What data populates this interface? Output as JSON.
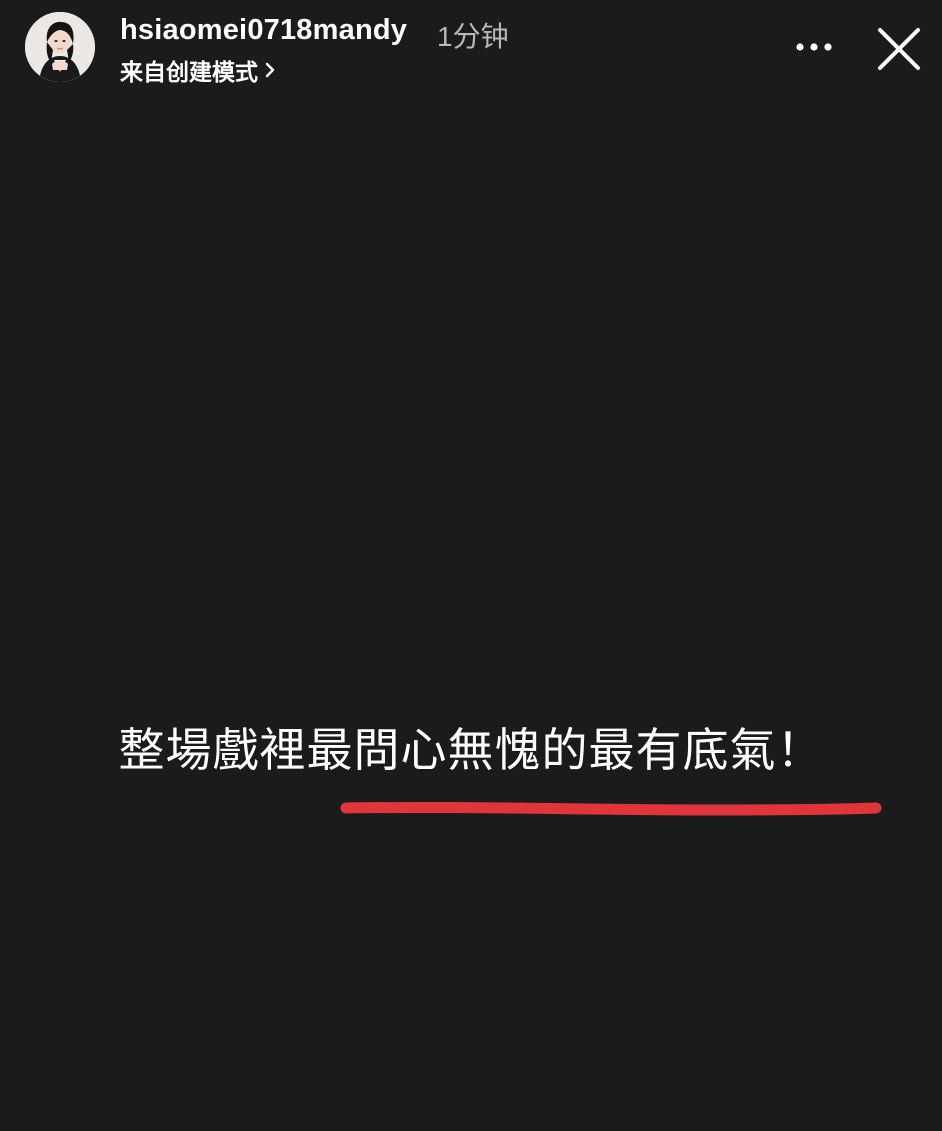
{
  "header": {
    "username": "hsiaomei0718mandy",
    "timestamp": "1分钟",
    "source_label": "来自创建模式"
  },
  "story": {
    "caption": "整場戲裡最問心無愧的最有底氣！"
  },
  "icons": {
    "avatar": "avatar",
    "chevron": "chevron-right-icon",
    "more": "more-dots-icon",
    "close": "close-icon"
  },
  "colors": {
    "background": "#1b1b1b",
    "text": "#ffffff",
    "timestamp": "#b8b8b8",
    "underline": "#e0353b"
  }
}
